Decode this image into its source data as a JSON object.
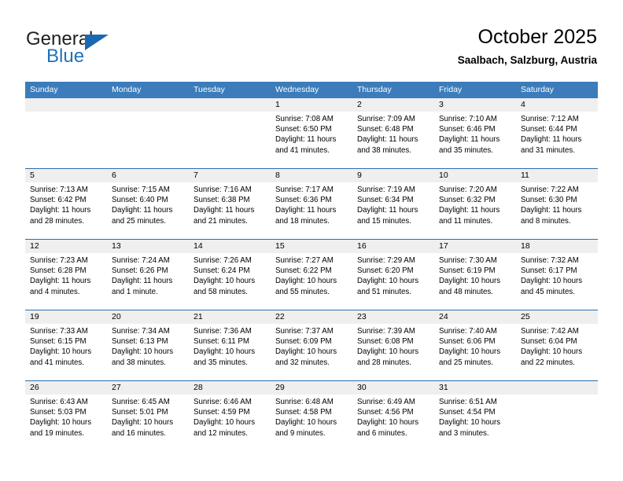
{
  "brand": {
    "word1": "General",
    "word2": "Blue",
    "logo_icon": "triangle-logo-icon",
    "accent_color": "#1a69b0"
  },
  "header": {
    "title": "October 2025",
    "subtitle": "Saalbach, Salzburg, Austria"
  },
  "calendar": {
    "header_bg": "#3c7cba",
    "day_strip_bg": "#efefef",
    "week_divider_color": "#2b6eb0",
    "weekday_headers": [
      "Sunday",
      "Monday",
      "Tuesday",
      "Wednesday",
      "Thursday",
      "Friday",
      "Saturday"
    ],
    "weeks": [
      [
        {
          "day": "",
          "sunrise": "",
          "sunset": "",
          "daylight1": "",
          "daylight2": ""
        },
        {
          "day": "",
          "sunrise": "",
          "sunset": "",
          "daylight1": "",
          "daylight2": ""
        },
        {
          "day": "",
          "sunrise": "",
          "sunset": "",
          "daylight1": "",
          "daylight2": ""
        },
        {
          "day": "1",
          "sunrise": "Sunrise: 7:08 AM",
          "sunset": "Sunset: 6:50 PM",
          "daylight1": "Daylight: 11 hours",
          "daylight2": "and 41 minutes."
        },
        {
          "day": "2",
          "sunrise": "Sunrise: 7:09 AM",
          "sunset": "Sunset: 6:48 PM",
          "daylight1": "Daylight: 11 hours",
          "daylight2": "and 38 minutes."
        },
        {
          "day": "3",
          "sunrise": "Sunrise: 7:10 AM",
          "sunset": "Sunset: 6:46 PM",
          "daylight1": "Daylight: 11 hours",
          "daylight2": "and 35 minutes."
        },
        {
          "day": "4",
          "sunrise": "Sunrise: 7:12 AM",
          "sunset": "Sunset: 6:44 PM",
          "daylight1": "Daylight: 11 hours",
          "daylight2": "and 31 minutes."
        }
      ],
      [
        {
          "day": "5",
          "sunrise": "Sunrise: 7:13 AM",
          "sunset": "Sunset: 6:42 PM",
          "daylight1": "Daylight: 11 hours",
          "daylight2": "and 28 minutes."
        },
        {
          "day": "6",
          "sunrise": "Sunrise: 7:15 AM",
          "sunset": "Sunset: 6:40 PM",
          "daylight1": "Daylight: 11 hours",
          "daylight2": "and 25 minutes."
        },
        {
          "day": "7",
          "sunrise": "Sunrise: 7:16 AM",
          "sunset": "Sunset: 6:38 PM",
          "daylight1": "Daylight: 11 hours",
          "daylight2": "and 21 minutes."
        },
        {
          "day": "8",
          "sunrise": "Sunrise: 7:17 AM",
          "sunset": "Sunset: 6:36 PM",
          "daylight1": "Daylight: 11 hours",
          "daylight2": "and 18 minutes."
        },
        {
          "day": "9",
          "sunrise": "Sunrise: 7:19 AM",
          "sunset": "Sunset: 6:34 PM",
          "daylight1": "Daylight: 11 hours",
          "daylight2": "and 15 minutes."
        },
        {
          "day": "10",
          "sunrise": "Sunrise: 7:20 AM",
          "sunset": "Sunset: 6:32 PM",
          "daylight1": "Daylight: 11 hours",
          "daylight2": "and 11 minutes."
        },
        {
          "day": "11",
          "sunrise": "Sunrise: 7:22 AM",
          "sunset": "Sunset: 6:30 PM",
          "daylight1": "Daylight: 11 hours",
          "daylight2": "and 8 minutes."
        }
      ],
      [
        {
          "day": "12",
          "sunrise": "Sunrise: 7:23 AM",
          "sunset": "Sunset: 6:28 PM",
          "daylight1": "Daylight: 11 hours",
          "daylight2": "and 4 minutes."
        },
        {
          "day": "13",
          "sunrise": "Sunrise: 7:24 AM",
          "sunset": "Sunset: 6:26 PM",
          "daylight1": "Daylight: 11 hours",
          "daylight2": "and 1 minute."
        },
        {
          "day": "14",
          "sunrise": "Sunrise: 7:26 AM",
          "sunset": "Sunset: 6:24 PM",
          "daylight1": "Daylight: 10 hours",
          "daylight2": "and 58 minutes."
        },
        {
          "day": "15",
          "sunrise": "Sunrise: 7:27 AM",
          "sunset": "Sunset: 6:22 PM",
          "daylight1": "Daylight: 10 hours",
          "daylight2": "and 55 minutes."
        },
        {
          "day": "16",
          "sunrise": "Sunrise: 7:29 AM",
          "sunset": "Sunset: 6:20 PM",
          "daylight1": "Daylight: 10 hours",
          "daylight2": "and 51 minutes."
        },
        {
          "day": "17",
          "sunrise": "Sunrise: 7:30 AM",
          "sunset": "Sunset: 6:19 PM",
          "daylight1": "Daylight: 10 hours",
          "daylight2": "and 48 minutes."
        },
        {
          "day": "18",
          "sunrise": "Sunrise: 7:32 AM",
          "sunset": "Sunset: 6:17 PM",
          "daylight1": "Daylight: 10 hours",
          "daylight2": "and 45 minutes."
        }
      ],
      [
        {
          "day": "19",
          "sunrise": "Sunrise: 7:33 AM",
          "sunset": "Sunset: 6:15 PM",
          "daylight1": "Daylight: 10 hours",
          "daylight2": "and 41 minutes."
        },
        {
          "day": "20",
          "sunrise": "Sunrise: 7:34 AM",
          "sunset": "Sunset: 6:13 PM",
          "daylight1": "Daylight: 10 hours",
          "daylight2": "and 38 minutes."
        },
        {
          "day": "21",
          "sunrise": "Sunrise: 7:36 AM",
          "sunset": "Sunset: 6:11 PM",
          "daylight1": "Daylight: 10 hours",
          "daylight2": "and 35 minutes."
        },
        {
          "day": "22",
          "sunrise": "Sunrise: 7:37 AM",
          "sunset": "Sunset: 6:09 PM",
          "daylight1": "Daylight: 10 hours",
          "daylight2": "and 32 minutes."
        },
        {
          "day": "23",
          "sunrise": "Sunrise: 7:39 AM",
          "sunset": "Sunset: 6:08 PM",
          "daylight1": "Daylight: 10 hours",
          "daylight2": "and 28 minutes."
        },
        {
          "day": "24",
          "sunrise": "Sunrise: 7:40 AM",
          "sunset": "Sunset: 6:06 PM",
          "daylight1": "Daylight: 10 hours",
          "daylight2": "and 25 minutes."
        },
        {
          "day": "25",
          "sunrise": "Sunrise: 7:42 AM",
          "sunset": "Sunset: 6:04 PM",
          "daylight1": "Daylight: 10 hours",
          "daylight2": "and 22 minutes."
        }
      ],
      [
        {
          "day": "26",
          "sunrise": "Sunrise: 6:43 AM",
          "sunset": "Sunset: 5:03 PM",
          "daylight1": "Daylight: 10 hours",
          "daylight2": "and 19 minutes."
        },
        {
          "day": "27",
          "sunrise": "Sunrise: 6:45 AM",
          "sunset": "Sunset: 5:01 PM",
          "daylight1": "Daylight: 10 hours",
          "daylight2": "and 16 minutes."
        },
        {
          "day": "28",
          "sunrise": "Sunrise: 6:46 AM",
          "sunset": "Sunset: 4:59 PM",
          "daylight1": "Daylight: 10 hours",
          "daylight2": "and 12 minutes."
        },
        {
          "day": "29",
          "sunrise": "Sunrise: 6:48 AM",
          "sunset": "Sunset: 4:58 PM",
          "daylight1": "Daylight: 10 hours",
          "daylight2": "and 9 minutes."
        },
        {
          "day": "30",
          "sunrise": "Sunrise: 6:49 AM",
          "sunset": "Sunset: 4:56 PM",
          "daylight1": "Daylight: 10 hours",
          "daylight2": "and 6 minutes."
        },
        {
          "day": "31",
          "sunrise": "Sunrise: 6:51 AM",
          "sunset": "Sunset: 4:54 PM",
          "daylight1": "Daylight: 10 hours",
          "daylight2": "and 3 minutes."
        },
        {
          "day": "",
          "sunrise": "",
          "sunset": "",
          "daylight1": "",
          "daylight2": ""
        }
      ]
    ]
  }
}
